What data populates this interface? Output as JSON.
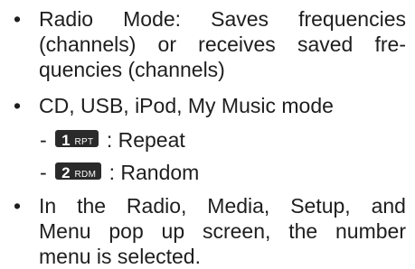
{
  "bullets": [
    {
      "lines": [
        [
          "Radio",
          "Mode:",
          "Saves",
          "frequencies"
        ],
        [
          "(channels)",
          "or",
          "receives",
          "saved",
          "fre-"
        ],
        [
          "quencies (channels)"
        ]
      ]
    },
    {
      "text": "CD, USB, iPod, My Music mode",
      "subitems": [
        {
          "dash": "-",
          "key_number": "1",
          "key_code": "RPT",
          "text": ": Repeat"
        },
        {
          "dash": "-",
          "key_number": "2",
          "key_code": "RDM",
          "text": ": Random"
        }
      ]
    },
    {
      "lines": [
        [
          "In",
          "the",
          "Radio,",
          "Media,",
          "Setup,",
          "and"
        ],
        [
          "Menu",
          "pop",
          "up",
          "screen,",
          "the",
          "number"
        ],
        [
          "menu is selected."
        ]
      ]
    }
  ],
  "bullet_symbol": "•"
}
